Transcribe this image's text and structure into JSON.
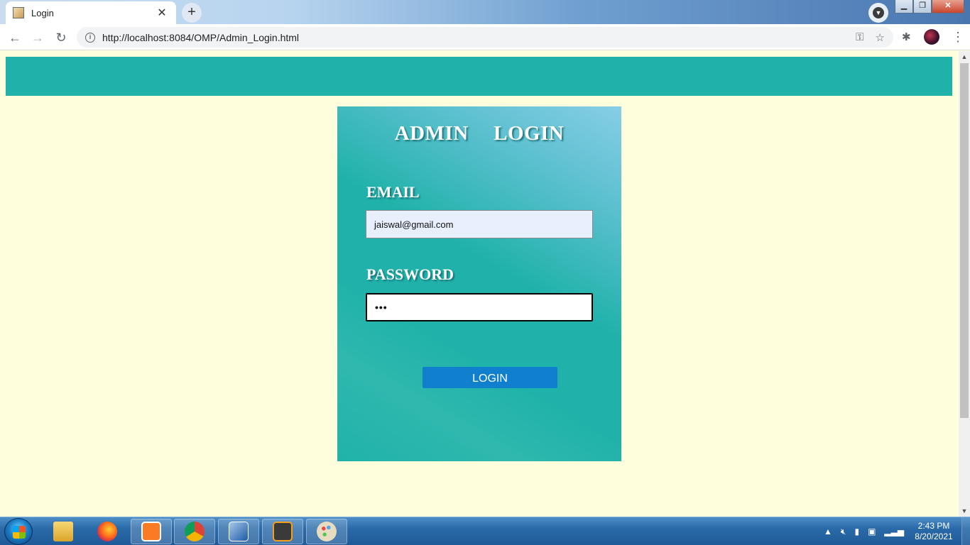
{
  "browser": {
    "tab_title": "Login",
    "tab_close": "✕",
    "new_tab": "+",
    "url": "http://localhost:8084/OMP/Admin_Login.html",
    "back": "←",
    "forward": "→",
    "reload": "↻",
    "key_icon": "⚿",
    "star_icon": "☆",
    "extensions_icon": "✱",
    "menu": "⋮",
    "profile_menu_icon": "▼",
    "window_minimize": "▁",
    "window_restore": "❐",
    "window_close": "✕"
  },
  "page": {
    "header_color": "#20b2aa",
    "background_color": "#fffedc"
  },
  "login": {
    "title": "ADMIN  LOGIN",
    "email_label": "EMAIL",
    "email_value": "jaiswal@gmail.com",
    "password_label": "PASSWORD",
    "password_value": "•••",
    "button_label": "LOGIN",
    "button_color": "#0f7fce"
  },
  "scrollbar": {
    "up": "▲",
    "down": "▼"
  },
  "taskbar": {
    "time": "2:43 PM",
    "date": "8/20/2021",
    "apps": [
      "file-explorer",
      "firefox",
      "xampp",
      "chrome",
      "virtualbox",
      "sublime-text",
      "paint"
    ],
    "tray": [
      "show-hidden-icons",
      "volume-muted",
      "signal",
      "network-error",
      "wifi"
    ]
  }
}
